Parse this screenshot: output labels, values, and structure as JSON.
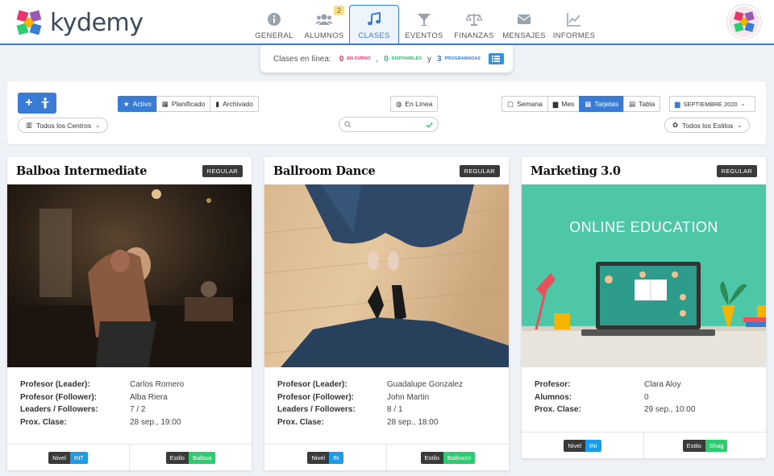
{
  "brand": {
    "name": "kydemy"
  },
  "nav": [
    {
      "label": "GENERAL",
      "icon": "info-icon"
    },
    {
      "label": "ALUMNOS",
      "icon": "users-icon",
      "badge": "2"
    },
    {
      "label": "CLASES",
      "icon": "music-note-icon",
      "active": true
    },
    {
      "label": "EVENTOS",
      "icon": "cocktail-icon"
    },
    {
      "label": "FINANZAS",
      "icon": "balance-scale-icon"
    },
    {
      "label": "MENSAJES",
      "icon": "envelope-icon"
    },
    {
      "label": "INFORMES",
      "icon": "chart-line-icon"
    }
  ],
  "online": {
    "prefix": "Clases en línea:",
    "in_progress_count": "0",
    "in_progress_label": "en curso",
    "sep": ",",
    "available_count": "0",
    "available_label": "disponibles",
    "and": "y",
    "scheduled_count": "3",
    "scheduled_label": "programadas"
  },
  "filters": {
    "status": [
      "Activo",
      "Planificado",
      "Archivado"
    ],
    "online": "En Línea",
    "views": [
      "Semana",
      "Mes",
      "Tarjetas",
      "Tabla"
    ],
    "month": "SEPTIEMBRE 2020",
    "centers": "Todos los Centros",
    "styles": "Todos los Estilos",
    "search_value": ""
  },
  "colors": {
    "primary": "#3a7bd5",
    "level": "#1e9be8",
    "style": "#2ecc71"
  },
  "cards": [
    {
      "title": "Balboa Intermediate",
      "tag": "REGULAR",
      "rows": [
        {
          "k": "Profesor (Leader):",
          "v": "Carlos Romero"
        },
        {
          "k": "Profesor (Follower):",
          "v": "Alba Riera"
        },
        {
          "k": "Leaders / Followers:",
          "v": "7 / 2"
        },
        {
          "k": "Prox. Clase:",
          "v": "28 sep., 19:00"
        }
      ],
      "level_label": "Nivel",
      "level": "INT",
      "style_label": "Estilo",
      "style": "Balboa"
    },
    {
      "title": "Ballroom Dance",
      "tag": "REGULAR",
      "rows": [
        {
          "k": "Profesor (Leader):",
          "v": "Guadalupe Gonzalez"
        },
        {
          "k": "Profesor (Follower):",
          "v": "John Martin"
        },
        {
          "k": "Leaders / Followers:",
          "v": "8 / 1"
        },
        {
          "k": "Prox. Clase:",
          "v": "28 sep., 18:00"
        }
      ],
      "level_label": "Nivel",
      "level": "IN",
      "style_label": "Estilo",
      "style": "Ballroom"
    },
    {
      "title": "Marketing 3.0",
      "tag": "REGULAR",
      "image_text": "ONLINE EDUCATION",
      "rows": [
        {
          "k": "Profesor:",
          "v": "Clara Aloy"
        },
        {
          "k": "Alumnos:",
          "v": "0"
        },
        {
          "k": "Prox. Clase:",
          "v": "29 sep., 10:00"
        }
      ],
      "level_label": "Nivel",
      "level": "INI",
      "style_label": "Estilo",
      "style": "Shag"
    }
  ]
}
